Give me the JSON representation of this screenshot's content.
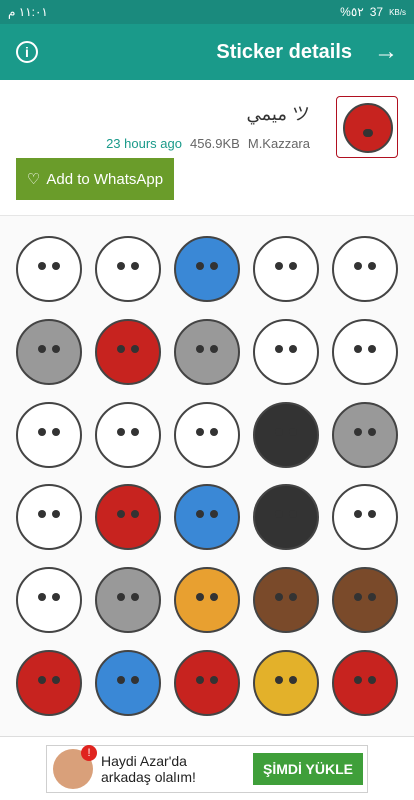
{
  "status_bar": {
    "time": "١١:٠١ م",
    "battery": "%٥٢",
    "network_speed": "37",
    "network_unit": "KB/s"
  },
  "appbar": {
    "title": "Sticker details",
    "info_icon": "info-icon",
    "back_icon": "arrow-right-icon"
  },
  "pack": {
    "name": "ميمي ツ",
    "time": "23 hours ago",
    "size": "456.9KB",
    "author": "M.Kazzara"
  },
  "add_button": {
    "label": "Add to WhatsApp",
    "icon": "heart-icon"
  },
  "stickers": [
    "s1",
    "s2",
    "s3",
    "s4",
    "s5",
    "s6",
    "s7",
    "s8",
    "s9",
    "s10",
    "s11",
    "s12",
    "s13",
    "s14",
    "s15",
    "s16",
    "s17",
    "s18",
    "s19",
    "s20",
    "s21",
    "s22",
    "s23",
    "s24",
    "s25",
    "s26",
    "s27",
    "s28",
    "s29",
    "s30"
  ],
  "ad": {
    "text_line1": "Haydi Azar'da",
    "text_line2": "arkadaş olalım!",
    "badge": "!",
    "button": "ŞİMDİ YÜKLE"
  }
}
